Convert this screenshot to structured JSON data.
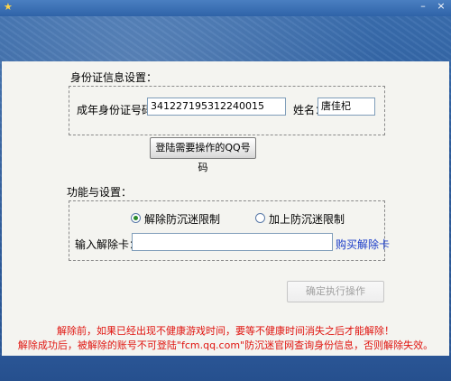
{
  "window": {
    "title": ""
  },
  "idcard": {
    "section_title": "身份证信息设置：",
    "id_label": "成年身份证号码：",
    "id_value": "341227195312240015",
    "name_label": "姓名：",
    "name_value": "唐佳杞",
    "login_button": "登陆需要操作的QQ号码"
  },
  "features": {
    "section_title": "功能与设置：",
    "radio_remove": "解除防沉迷限制",
    "radio_add": "加上防沉迷限制",
    "selected": "radio_remove",
    "card_label": "输入解除卡：",
    "card_value": "",
    "buy_link": "购买解除卡",
    "execute_button": "确定执行操作"
  },
  "notices": {
    "line1": "解除前，如果已经出现不健康游戏时间，要等不健康时间消失之后才能解除！",
    "line2": "解除成功后，被解除的账号不可登陆\"fcm.qq.com\"防沉迷官网查询身份信息，否则解除失效。"
  },
  "colors": {
    "warning": "#e0140f",
    "link": "#1a3cc8",
    "radio_selected": "#2a8a2a"
  },
  "icons": {
    "title": "app-icon",
    "minimize": "minimize-icon",
    "close": "close-icon"
  }
}
